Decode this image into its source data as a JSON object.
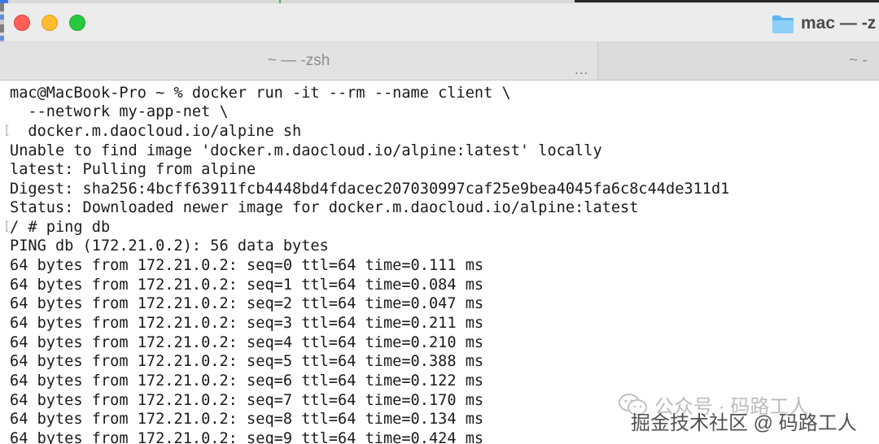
{
  "window": {
    "title": "mac — -z",
    "colors": {
      "close": "#fe5f57",
      "minimize": "#febc2e",
      "zoom": "#28c840"
    }
  },
  "tabs": [
    {
      "label": "~ — -zsh",
      "more": "..."
    },
    {
      "label": "~ -"
    }
  ],
  "terminal": {
    "lines": [
      "mac@MacBook-Pro ~ % docker run -it --rm --name client \\",
      "  --network my-app-net \\",
      "  docker.m.daocloud.io/alpine sh",
      "Unable to find image 'docker.m.daocloud.io/alpine:latest' locally",
      "latest: Pulling from alpine",
      "Digest: sha256:4bcff63911fcb4448bd4fdacec207030997caf25e9bea4045fa6c8c44de311d1",
      "Status: Downloaded newer image for docker.m.daocloud.io/alpine:latest",
      "/ # ping db",
      "PING db (172.21.0.2): 56 data bytes",
      "64 bytes from 172.21.0.2: seq=0 ttl=64 time=0.111 ms",
      "64 bytes from 172.21.0.2: seq=1 ttl=64 time=0.084 ms",
      "64 bytes from 172.21.0.2: seq=2 ttl=64 time=0.047 ms",
      "64 bytes from 172.21.0.2: seq=3 ttl=64 time=0.211 ms",
      "64 bytes from 172.21.0.2: seq=4 ttl=64 time=0.210 ms",
      "64 bytes from 172.21.0.2: seq=5 ttl=64 time=0.388 ms",
      "64 bytes from 172.21.0.2: seq=6 ttl=64 time=0.122 ms",
      "64 bytes from 172.21.0.2: seq=7 ttl=64 time=0.170 ms",
      "64 bytes from 172.21.0.2: seq=8 ttl=64 time=0.134 ms",
      "64 bytes from 172.21.0.2: seq=9 ttl=64 time=0.424 ms"
    ],
    "marks": [
      "[",
      "["
    ]
  },
  "watermark": {
    "primary": "公众号 · 码路工人",
    "secondary": "掘金技术社区 @ 码路工人"
  }
}
